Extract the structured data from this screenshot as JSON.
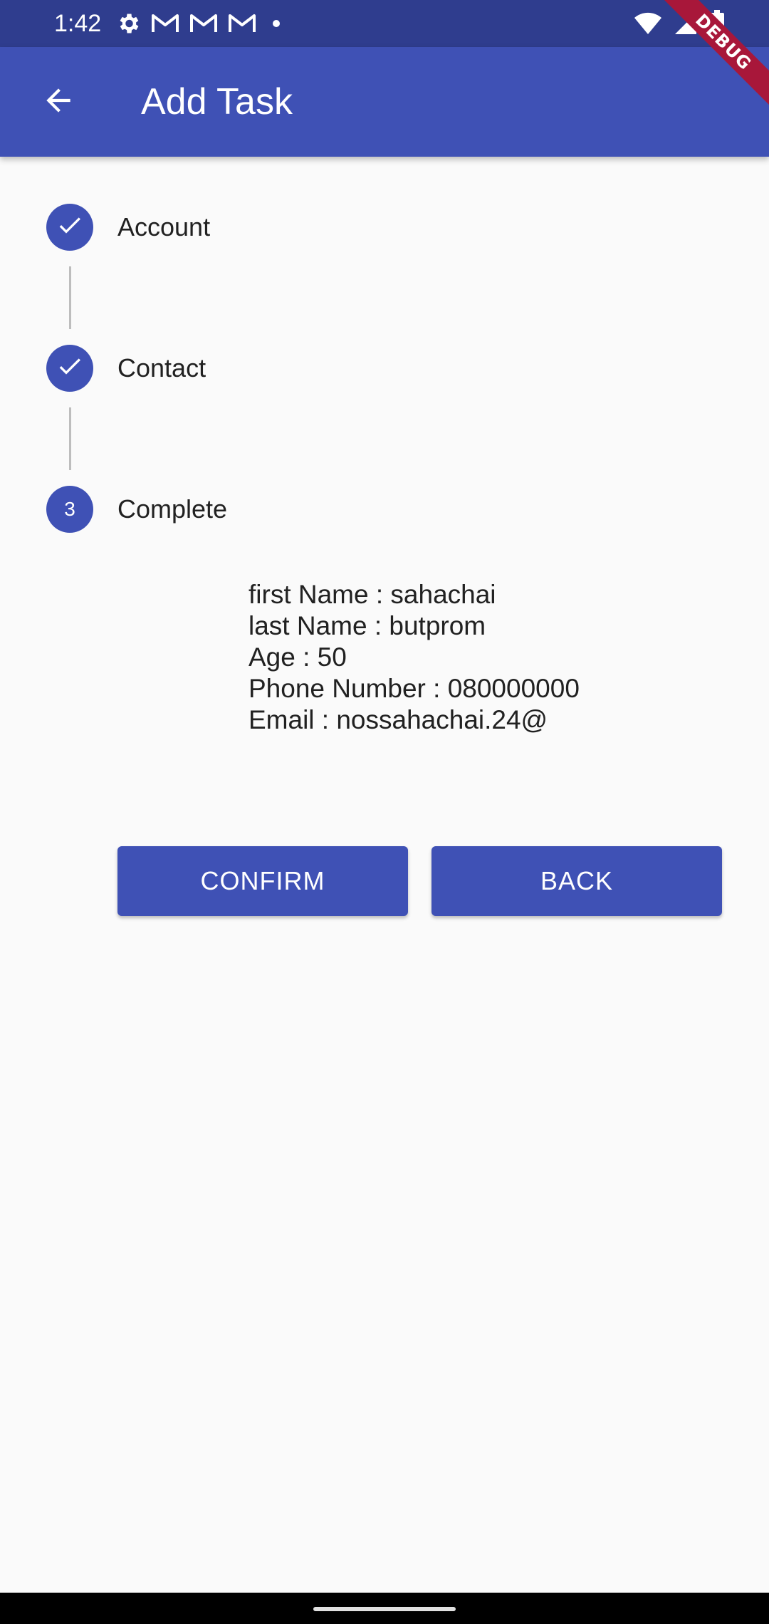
{
  "status_bar": {
    "time": "1:42",
    "left_icons": [
      "gear-icon",
      "gmail-icon",
      "gmail-icon",
      "gmail-icon",
      "dot-icon"
    ],
    "right_icons": [
      "wifi-icon",
      "signal-icon",
      "battery-icon"
    ]
  },
  "debug_banner": "DEBUG",
  "app_bar": {
    "title": "Add Task",
    "back_icon": "arrow-back-icon",
    "color": "#3f51b5"
  },
  "stepper": {
    "steps": [
      {
        "label": "Account",
        "state": "completed",
        "marker": "check-icon"
      },
      {
        "label": "Contact",
        "state": "completed",
        "marker": "check-icon"
      },
      {
        "label": "Complete",
        "state": "active",
        "marker": "3"
      }
    ]
  },
  "summary": {
    "lines": [
      "first Name : sahachai",
      "last Name : butprom",
      "Age : 50",
      "Phone Number : 080000000",
      "Email : nossahachai.24@"
    ]
  },
  "buttons": {
    "confirm": "CONFIRM",
    "back": "BACK"
  }
}
